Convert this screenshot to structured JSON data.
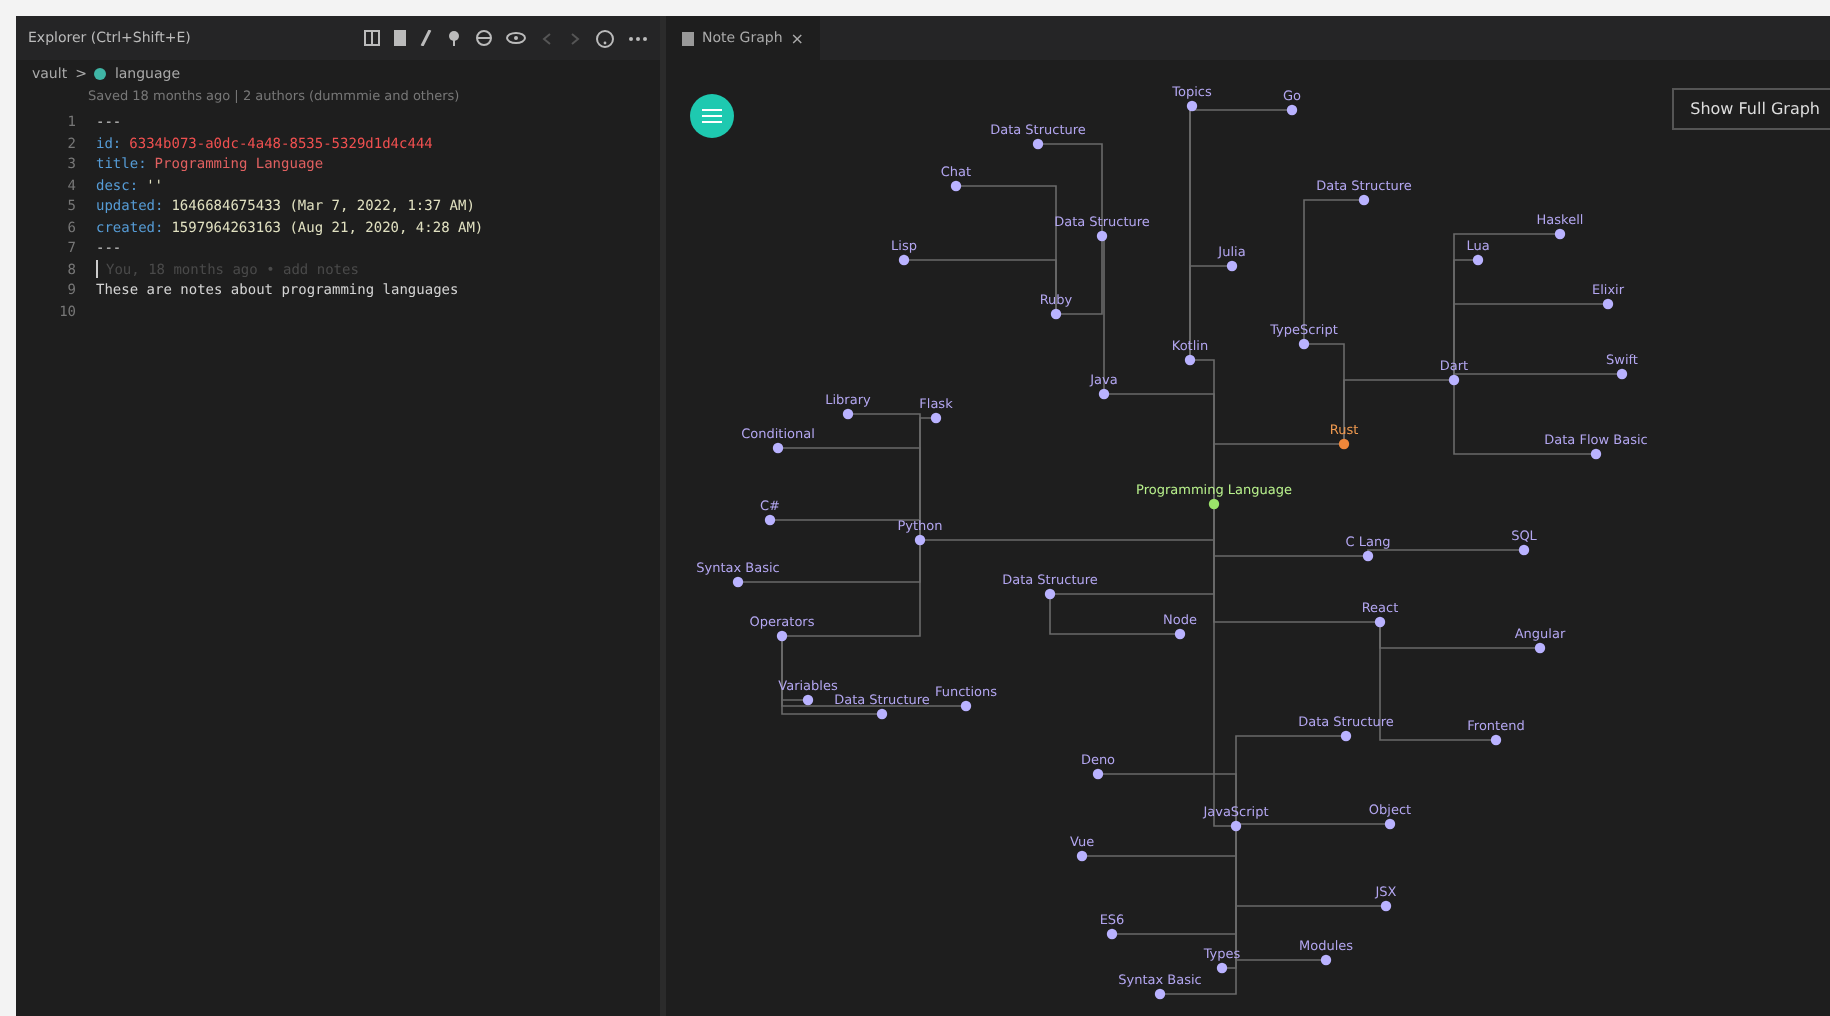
{
  "explorer": {
    "title": "Explorer (Ctrl+Shift+E)"
  },
  "breadcrumb": {
    "folder": "vault",
    "separator": ">",
    "file": "language"
  },
  "blame": "Saved 18 months ago | 2 authors (dummmie and others)",
  "lines": [
    {
      "number": "1",
      "kind": "plain",
      "text": "---"
    },
    {
      "number": "2",
      "kind": "id",
      "key": "id:",
      "text": "6334b073-a0dc-4a48-8535-5329d1d4c444"
    },
    {
      "number": "3",
      "kind": "title",
      "key": "title:",
      "text": "Programming Language"
    },
    {
      "number": "4",
      "kind": "field",
      "key": "desc:",
      "text": "''"
    },
    {
      "number": "5",
      "kind": "field",
      "key": "updated:",
      "text": "1646684675433 (Mar 7, 2022, 1:37 AM)"
    },
    {
      "number": "6",
      "kind": "field",
      "key": "created:",
      "text": "1597964263163 (Aug 21, 2020, 4:28 AM)"
    },
    {
      "number": "7",
      "kind": "plain",
      "text": "---"
    },
    {
      "number": "8",
      "kind": "cursor",
      "text": "You, 18 months ago • add notes"
    },
    {
      "number": "9",
      "kind": "plain",
      "text": "These are notes about programming languages"
    },
    {
      "number": "10",
      "kind": "plain"
    }
  ],
  "graph_tab": {
    "label": "Note Graph",
    "close": "×"
  },
  "graph": {
    "button": "Show Full Graph",
    "nodes": [
      {
        "label": "Programming Language",
        "kind": "root"
      },
      {
        "label": "Rust",
        "kind": "highlight"
      },
      {
        "label": "Python",
        "kind": "normal"
      },
      {
        "label": "JavaScript",
        "kind": "normal"
      },
      {
        "label": "Java",
        "kind": "normal"
      },
      {
        "label": "Kotlin",
        "kind": "normal"
      },
      {
        "label": "TypeScript",
        "kind": "normal"
      },
      {
        "label": "Dart",
        "kind": "normal"
      },
      {
        "label": "Data Structure",
        "kind": "normal"
      },
      {
        "label": "Data Structure",
        "kind": "normal"
      },
      {
        "label": "Ruby",
        "kind": "normal"
      },
      {
        "label": "Chat",
        "kind": "normal"
      },
      {
        "label": "Lisp",
        "kind": "normal"
      },
      {
        "label": "Go",
        "kind": "normal"
      },
      {
        "label": "Topics",
        "kind": "normal"
      },
      {
        "label": "Julia",
        "kind": "normal"
      },
      {
        "label": "Data Structure",
        "kind": "normal"
      },
      {
        "label": "Lua",
        "kind": "normal"
      },
      {
        "label": "Haskell",
        "kind": "normal"
      },
      {
        "label": "Elixir",
        "kind": "normal"
      },
      {
        "label": "Swift",
        "kind": "normal"
      },
      {
        "label": "Data Flow Basic",
        "kind": "normal"
      },
      {
        "label": "Library",
        "kind": "normal"
      },
      {
        "label": "Flask",
        "kind": "normal"
      },
      {
        "label": "Conditional",
        "kind": "normal"
      },
      {
        "label": "C#",
        "kind": "normal"
      },
      {
        "label": "Syntax Basic",
        "kind": "normal"
      },
      {
        "label": "Operators",
        "kind": "normal"
      },
      {
        "label": "Variables",
        "kind": "normal"
      },
      {
        "label": "Data Structure",
        "kind": "normal"
      },
      {
        "label": "Functions",
        "kind": "normal"
      },
      {
        "label": "Data Structure",
        "kind": "normal"
      },
      {
        "label": "Node",
        "kind": "normal"
      },
      {
        "label": "C Lang",
        "kind": "normal"
      },
      {
        "label": "SQL",
        "kind": "normal"
      },
      {
        "label": "React",
        "kind": "normal"
      },
      {
        "label": "Angular",
        "kind": "normal"
      },
      {
        "label": "Frontend",
        "kind": "normal"
      },
      {
        "label": "Data Structure",
        "kind": "normal"
      },
      {
        "label": "Deno",
        "kind": "normal"
      },
      {
        "label": "Vue",
        "kind": "normal"
      },
      {
        "label": "Object",
        "kind": "normal"
      },
      {
        "label": "JSX",
        "kind": "normal"
      },
      {
        "label": "ES6",
        "kind": "normal"
      },
      {
        "label": "Types",
        "kind": "normal"
      },
      {
        "label": "Modules",
        "kind": "normal"
      },
      {
        "label": "Syntax Basic",
        "kind": "normal"
      }
    ]
  }
}
